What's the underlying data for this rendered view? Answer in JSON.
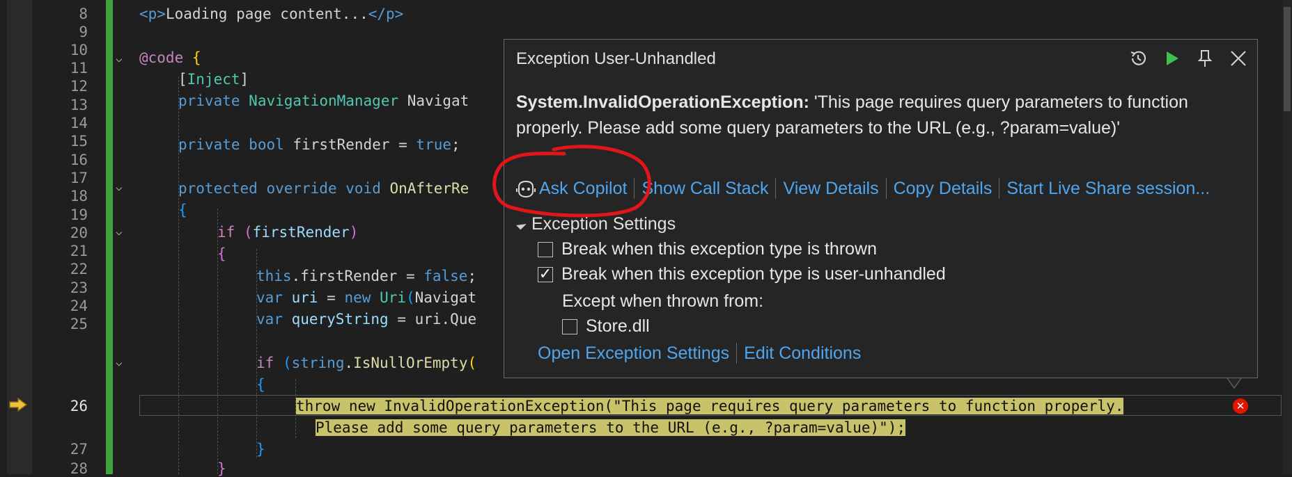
{
  "editor": {
    "line_numbers": [
      "8",
      "9",
      "10",
      "11",
      "12",
      "13",
      "14",
      "15",
      "16",
      "17",
      "18",
      "19",
      "20",
      "21",
      "22",
      "23",
      "24",
      "25",
      "26",
      "27",
      "28"
    ],
    "lines": {
      "l8_open": "<p>",
      "l8_text": "Loading page content...",
      "l8_close": "</p>",
      "l10_at": "@code",
      "l10_brace": "{",
      "l11_open": "[",
      "l11_attr": "Inject",
      "l11_close": "]",
      "l12_kw": "private",
      "l12_type": "NavigationManager",
      "l12_rest": "Navigat",
      "l14_kw": "private",
      "l14_type": "bool",
      "l14_rest": "firstRender = ",
      "l14_val": "true",
      "l14_end": ";",
      "l16_kw1": "protected",
      "l16_kw2": "override",
      "l16_kw3": "void",
      "l16_fn": "OnAfterRe",
      "l17_brace": "{",
      "l18_kw": "if",
      "l18_p1": "(",
      "l18_var": "firstRender",
      "l18_p2": ")",
      "l19_brace": "{",
      "l20_this": "this",
      "l20_rest": ".firstRender = ",
      "l20_val": "false",
      "l20_end": ";",
      "l21_kw": "var",
      "l21_var": "uri",
      "l21_eq": " = ",
      "l21_new": "new",
      "l21_type": "Uri",
      "l21_p": "(",
      "l21_rest": "Navigat",
      "l22_kw": "var",
      "l22_var": "queryString",
      "l22_eq": " = ",
      "l22_rest": "uri.Que",
      "l24_kw": "if",
      "l24_p": "(",
      "l24_type": "string",
      "l24_fn": ".IsNullOrEmpty",
      "l24_p2": "(",
      "l25_brace": "{",
      "l26_a": "throw new InvalidOperationException(\"This page requires query parameters to function properly.",
      "l26_b": "Please add some query parameters to the URL (e.g., ?param=value)\");",
      "l27_brace": "}",
      "l28_brace": "}"
    }
  },
  "popup": {
    "title": "Exception User-Unhandled",
    "exception_type": "System.InvalidOperationException:",
    "exception_message": " 'This page requires query parameters to function properly. Please add some query parameters to the URL (e.g., ?param=value)'",
    "actions": [
      "Ask Copilot",
      "Show Call Stack",
      "View Details",
      "Copy Details",
      "Start Live Share session..."
    ],
    "settings_header": "Exception Settings",
    "option_thrown": "Break when this exception type is thrown",
    "option_thrown_checked": false,
    "option_unhandled": "Break when this exception type is user-unhandled",
    "option_unhandled_checked": true,
    "except_label": "Except when thrown from:",
    "module_option": "Store.dll",
    "module_checked": false,
    "bottom_links": [
      "Open Exception Settings",
      "Edit Conditions"
    ]
  },
  "colors": {
    "link": "#4fa6f0",
    "highlight": "#c8c36a",
    "error": "#e51400",
    "annotation": "#e0161b",
    "gutter_modified": "#3fa33f"
  },
  "icons": {
    "history": "history-icon",
    "continue": "play-icon",
    "pin": "pin-icon",
    "close": "close-icon",
    "copilot": "copilot-icon",
    "execution_pointer": "execution-arrow-icon",
    "error": "error-icon"
  }
}
